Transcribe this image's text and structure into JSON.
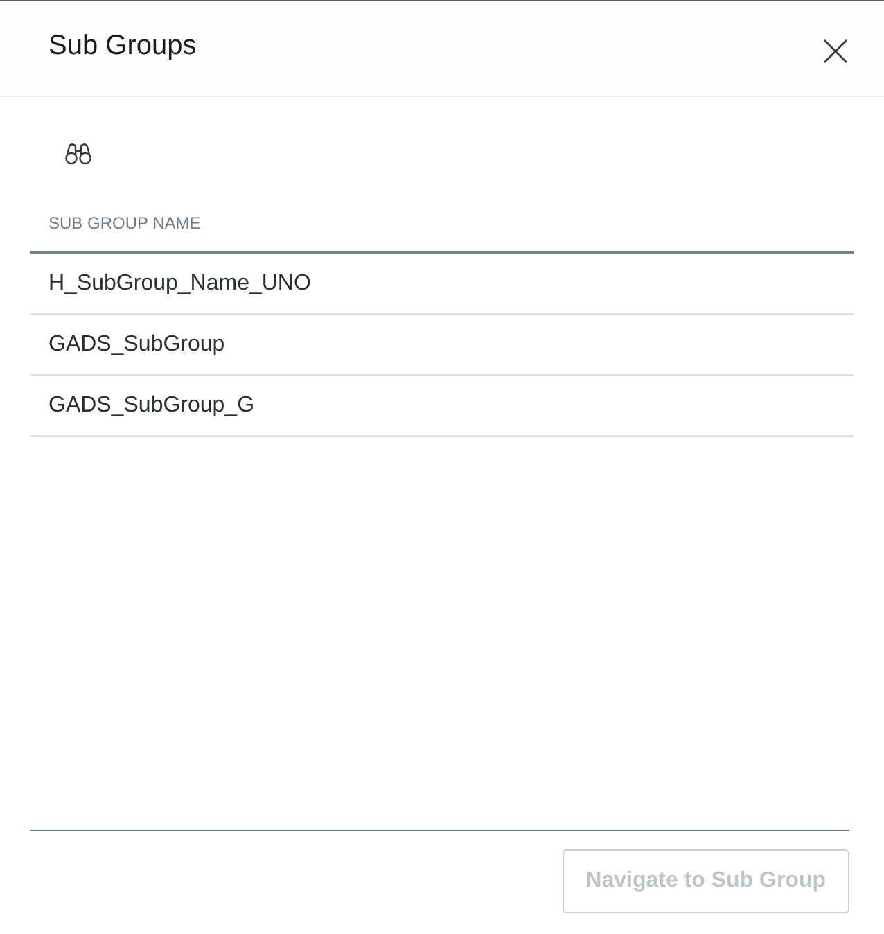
{
  "dialog": {
    "title": "Sub Groups"
  },
  "table": {
    "columns": [
      "SUB GROUP NAME"
    ],
    "rows": [
      {
        "cells": [
          "H_SubGroup_Name_UNO"
        ],
        "selected": false
      },
      {
        "cells": [
          "GADS_SubGroup"
        ],
        "selected": false
      },
      {
        "cells": [
          "GADS_SubGroup_G"
        ],
        "selected": false
      }
    ]
  },
  "footer": {
    "buttons": [
      {
        "label": "Navigate to Sub Group",
        "disabled": true
      }
    ]
  }
}
